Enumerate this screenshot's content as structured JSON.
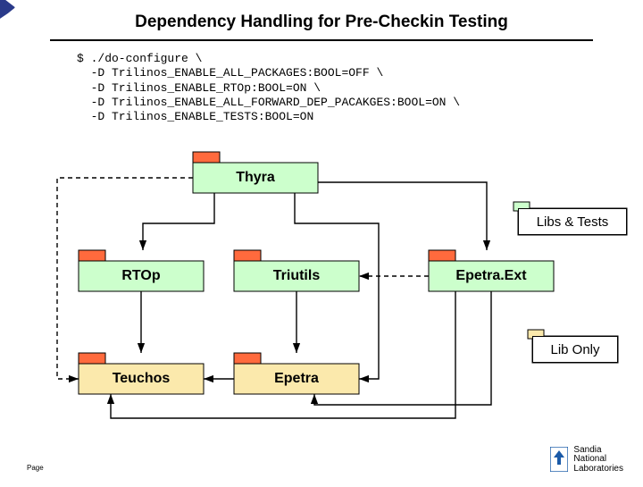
{
  "title": "Dependency Handling for Pre-Checkin Testing",
  "code": "$ ./do-configure \\\n  -D Trilinos_ENABLE_ALL_PACKAGES:BOOL=OFF \\\n  -D Trilinos_ENABLE_RTOp:BOOL=ON \\\n  -D Trilinos_ENABLE_ALL_FORWARD_DEP_PACAKGES:BOOL=ON \\\n  -D Trilinos_ENABLE_TESTS:BOOL=ON",
  "packages": {
    "thyra": "Thyra",
    "rtop": "RTOp",
    "triutils": "Triutils",
    "epetraext": "Epetra.Ext",
    "teuchos": "Teuchos",
    "epetra": "Epetra"
  },
  "legend": {
    "libs_tests": "Libs & Tests",
    "lib_only": "Lib Only"
  },
  "colors": {
    "required": "#ccffcc",
    "optional": "#fbe9ac",
    "tab": "#ff6a3d",
    "white": "#ffffff"
  },
  "footer": {
    "page": "Page",
    "org": "Sandia\nNational\nLaboratories"
  }
}
